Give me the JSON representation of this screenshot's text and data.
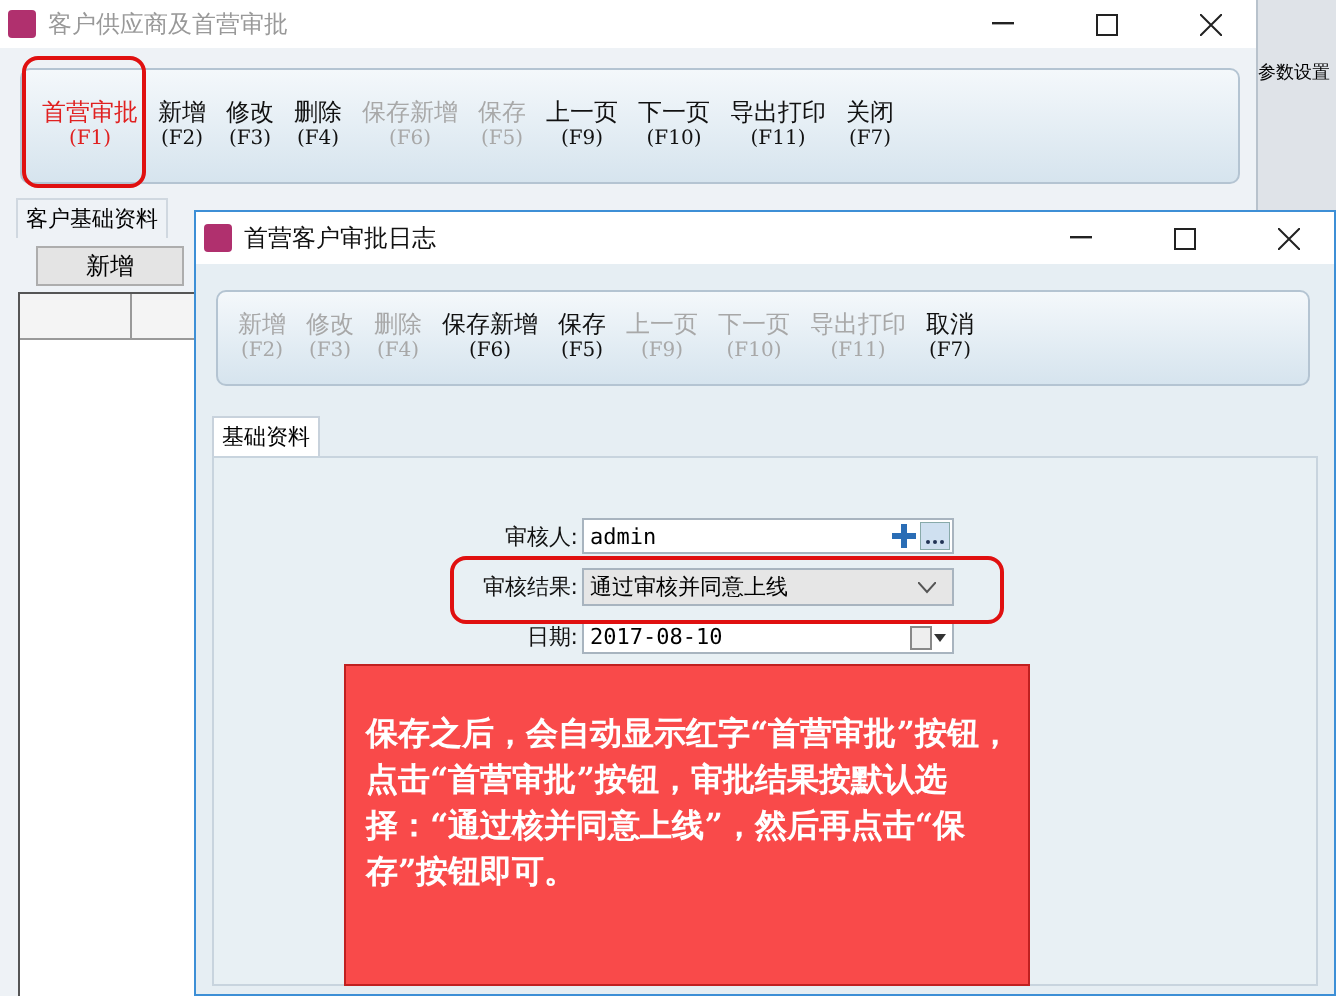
{
  "main_window": {
    "title": "客户供应商及首营审批",
    "toolbar": [
      {
        "label": "首营审批",
        "key": "(F1)",
        "disabled": false,
        "alert": true
      },
      {
        "label": "新增",
        "key": "(F2)",
        "disabled": false,
        "alert": false
      },
      {
        "label": "修改",
        "key": "(F3)",
        "disabled": false,
        "alert": false
      },
      {
        "label": "删除",
        "key": "(F4)",
        "disabled": false,
        "alert": false
      },
      {
        "label": "保存新增",
        "key": "(F6)",
        "disabled": true,
        "alert": false
      },
      {
        "label": "保存",
        "key": "(F5)",
        "disabled": true,
        "alert": false
      },
      {
        "label": "上一页",
        "key": "(F9)",
        "disabled": false,
        "alert": false
      },
      {
        "label": "下一页",
        "key": "(F10)",
        "disabled": false,
        "alert": false
      },
      {
        "label": "导出打印",
        "key": "(F11)",
        "disabled": false,
        "alert": false
      },
      {
        "label": "关闭",
        "key": "(F7)",
        "disabled": false,
        "alert": false
      }
    ],
    "tabs": [
      {
        "label": "客户基础资料",
        "selected": false
      }
    ],
    "add_button": "新增"
  },
  "background_window": {
    "menu_item": "参数设置"
  },
  "dialog": {
    "title": "首营客户审批日志",
    "toolbar": [
      {
        "label": "新增",
        "key": "(F2)",
        "disabled": true
      },
      {
        "label": "修改",
        "key": "(F3)",
        "disabled": true
      },
      {
        "label": "删除",
        "key": "(F4)",
        "disabled": true
      },
      {
        "label": "保存新增",
        "key": "(F6)",
        "disabled": false
      },
      {
        "label": "保存",
        "key": "(F5)",
        "disabled": false
      },
      {
        "label": "上一页",
        "key": "(F9)",
        "disabled": true
      },
      {
        "label": "下一页",
        "key": "(F10)",
        "disabled": true
      },
      {
        "label": "导出打印",
        "key": "(F11)",
        "disabled": true
      },
      {
        "label": "取消",
        "key": "(F7)",
        "disabled": false
      }
    ],
    "tabs": [
      {
        "label": "基础资料",
        "selected": true
      }
    ],
    "form": [
      {
        "kind": "lookup",
        "label": "审核人:",
        "value": "admin"
      },
      {
        "kind": "select",
        "label": "审核结果:",
        "value": "通过审核并同意上线"
      },
      {
        "kind": "date",
        "label": "日期:",
        "value": "2017-08-10"
      }
    ]
  },
  "callout": "保存之后，会自动显示红字“首营审批”按钮，点击“首营审批”按钮，审批结果按默认选择：“通过核并同意上线”，然后再点击“保存”按钮即可。"
}
